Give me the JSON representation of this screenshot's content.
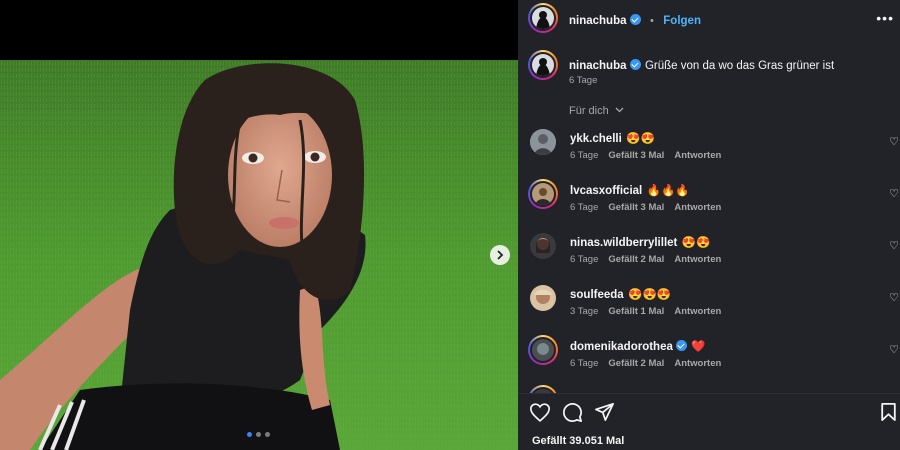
{
  "post": {
    "username": "ninachuba",
    "follow_label": "Folgen",
    "separator": "•",
    "caption": "Grüße von da wo das Gras grüner ist",
    "caption_age": "6 Tage",
    "slide_count": 3,
    "active_slide": 1
  },
  "comments_sort_label": "Für dich",
  "comments": [
    {
      "username": "ykk.chelli",
      "text": "😍😍",
      "age": "6 Tage",
      "likes": "Gefällt 3 Mal",
      "reply": "Antworten"
    },
    {
      "username": "lvcasxofficial",
      "text": "🔥🔥🔥",
      "age": "6 Tage",
      "likes": "Gefällt 3 Mal",
      "reply": "Antworten"
    },
    {
      "username": "ninas.wildberrylillet",
      "text": "😍😍",
      "age": "6 Tage",
      "likes": "Gefällt 2 Mal",
      "reply": "Antworten"
    },
    {
      "username": "soulfeeda",
      "text": "😍😍😍",
      "age": "3 Tage",
      "likes": "Gefällt 1 Mal",
      "reply": "Antworten"
    },
    {
      "username": "domenikadorothea",
      "text": "❤️",
      "age": "6 Tage",
      "likes": "Gefällt 2 Mal",
      "reply": "Antworten",
      "verified": true
    }
  ],
  "likes_total": "Gefällt 39.051 Mal",
  "icons": {
    "more": "more-options-icon",
    "like": "heart-icon",
    "comment": "comment-icon",
    "share": "send-icon",
    "save": "bookmark-icon",
    "next": "chevron-right-icon"
  },
  "colors": {
    "panel_bg": "#222229",
    "accent_blue": "#4cb5f9",
    "verified_blue": "#3897f0",
    "secondary_text": "#a8a8a8"
  }
}
